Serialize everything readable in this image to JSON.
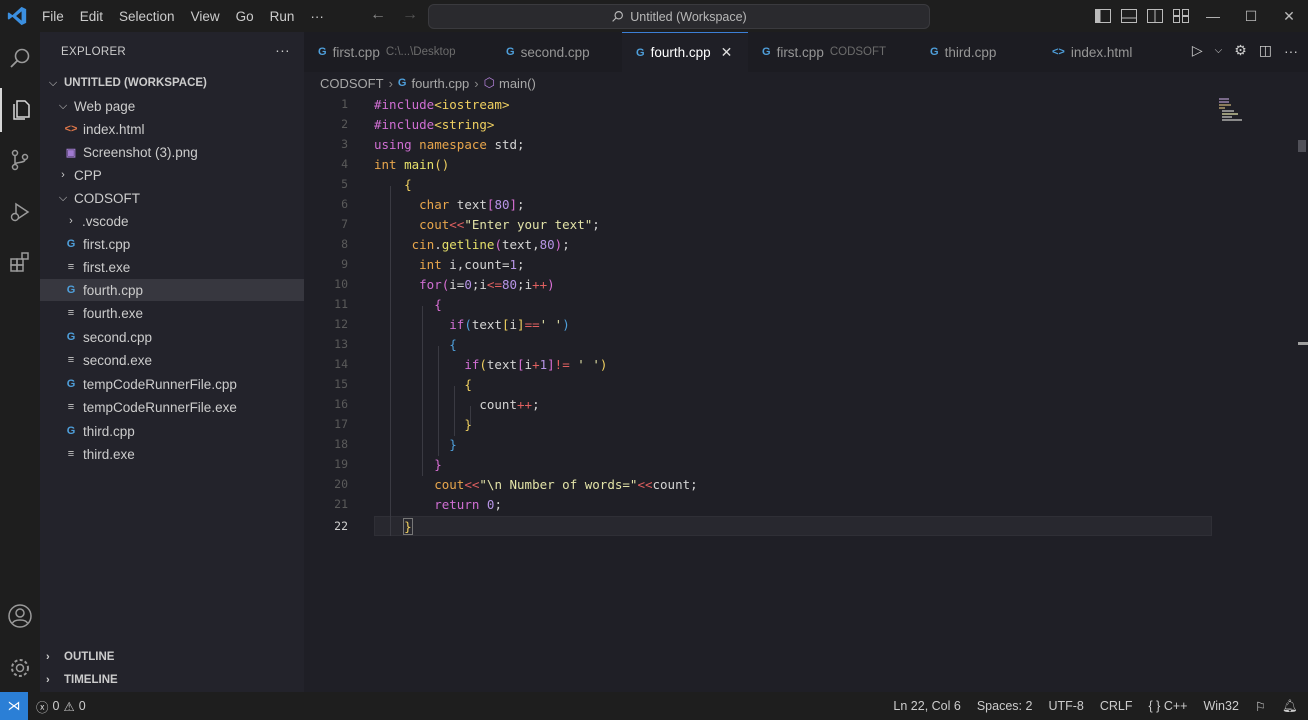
{
  "titlebar": {
    "menu": [
      "File",
      "Edit",
      "Selection",
      "View",
      "Go",
      "Run",
      "···"
    ],
    "search_text": "Untitled (Workspace)",
    "nav_back": "←",
    "nav_forward": "→"
  },
  "sidebar": {
    "title": "EXPLORER",
    "more": "···",
    "workspace": "UNTITLED (WORKSPACE)",
    "items": [
      {
        "label": "Web page",
        "kind": "folder-open"
      },
      {
        "label": "index.html",
        "kind": "html"
      },
      {
        "label": "Screenshot (3).png",
        "kind": "png"
      },
      {
        "label": "CPP",
        "kind": "folder-closed"
      },
      {
        "label": "CODSOFT",
        "kind": "folder-open"
      },
      {
        "label": ".vscode",
        "kind": "folder-closed"
      },
      {
        "label": "first.cpp",
        "kind": "cpp"
      },
      {
        "label": "first.exe",
        "kind": "exe"
      },
      {
        "label": "fourth.cpp",
        "kind": "cpp"
      },
      {
        "label": "fourth.exe",
        "kind": "exe"
      },
      {
        "label": "second.cpp",
        "kind": "cpp"
      },
      {
        "label": "second.exe",
        "kind": "exe"
      },
      {
        "label": "tempCodeRunnerFile.cpp",
        "kind": "cpp"
      },
      {
        "label": "tempCodeRunnerFile.exe",
        "kind": "exe"
      },
      {
        "label": "third.cpp",
        "kind": "cpp"
      },
      {
        "label": "third.exe",
        "kind": "exe"
      }
    ],
    "outline": "OUTLINE",
    "timeline": "TIMELINE"
  },
  "tabs": [
    {
      "label": "first.cpp",
      "desc": "C:\\...\\Desktop",
      "icon": "cpp-icon"
    },
    {
      "label": "second.cpp",
      "desc": "",
      "icon": "cpp-icon"
    },
    {
      "label": "fourth.cpp",
      "desc": "",
      "icon": "cpp-icon",
      "close": "✕"
    },
    {
      "label": "first.cpp",
      "desc": "CODSOFT",
      "icon": "cpp-icon"
    },
    {
      "label": "third.cpp",
      "desc": "",
      "icon": "cpp-icon"
    },
    {
      "label": "index.html",
      "desc": "",
      "icon": "html-icon"
    }
  ],
  "breadcrumb": {
    "folder": "CODSOFT",
    "file": "fourth.cpp",
    "symbol": "main()"
  },
  "editor": {
    "line_numbers": [
      "1",
      "2",
      "3",
      "4",
      "5",
      "6",
      "7",
      "8",
      "9",
      "10",
      "11",
      "12",
      "13",
      "14",
      "15",
      "16",
      "17",
      "18",
      "19",
      "20",
      "21",
      "22"
    ],
    "current_line": "22"
  },
  "statusbar": {
    "errors": "0",
    "warnings": "0",
    "position": "Ln 22, Col 6",
    "spaces": "Spaces: 2",
    "encoding": "UTF-8",
    "eol": "CRLF",
    "language": "C++",
    "platform": "Win32"
  },
  "colors": {
    "accent": "#2b7fd6",
    "keyword": "#e8a64c",
    "preprocessor": "#d06fd3",
    "string": "#e3e3a8"
  }
}
